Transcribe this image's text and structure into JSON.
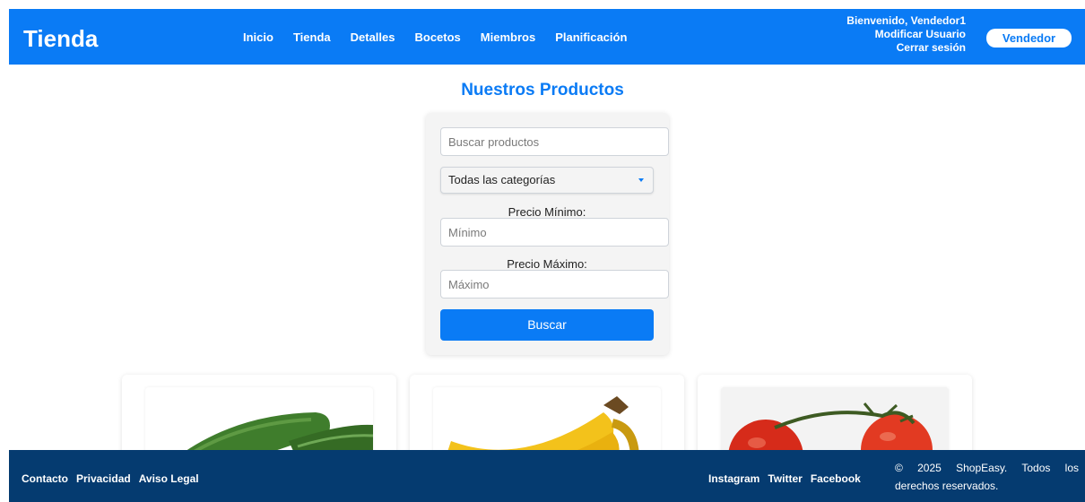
{
  "header": {
    "brand": "Tienda",
    "nav": [
      "Inicio",
      "Tienda",
      "Detalles",
      "Bocetos",
      "Miembros",
      "Planificación"
    ],
    "welcome": "Bienvenido, Vendedor1",
    "edit_user": "Modificar Usuario",
    "logout": "Cerrar sesión",
    "role_button": "Vendedor"
  },
  "main": {
    "title": "Nuestros Productos"
  },
  "filters": {
    "search_placeholder": "Buscar productos",
    "category_selected": "Todas las categorías",
    "min_label": "Precio Mínimo:",
    "min_placeholder": "Mínimo",
    "max_label": "Precio Máximo:",
    "max_placeholder": "Máximo",
    "search_button": "Buscar"
  },
  "products": [
    {
      "image": "cucumber"
    },
    {
      "image": "banana"
    },
    {
      "image": "tomato"
    }
  ],
  "footer": {
    "left_links": [
      "Contacto",
      "Privacidad",
      "Aviso Legal"
    ],
    "social_links": [
      "Instagram",
      "Twitter",
      "Facebook"
    ],
    "copyright": "© 2025 ShopEasy. Todos los derechos reservados."
  },
  "colors": {
    "primary": "#0a7bf5",
    "footer": "#053b70"
  }
}
